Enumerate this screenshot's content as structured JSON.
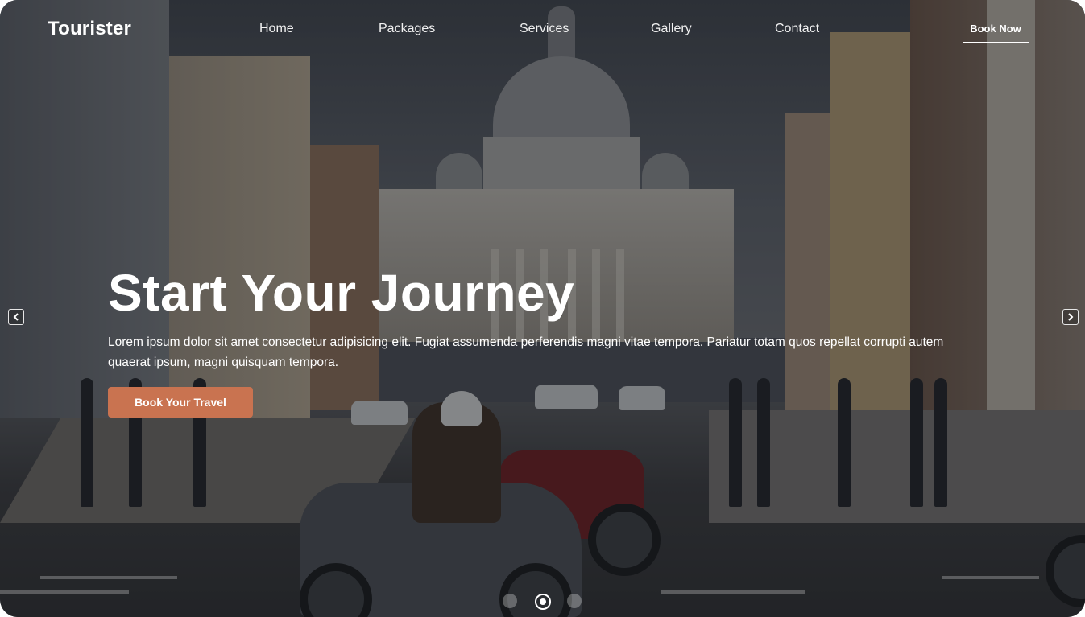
{
  "brand": {
    "name": "Tourister"
  },
  "nav": {
    "links": [
      "Home",
      "Packages",
      "Services",
      "Gallery",
      "Contact"
    ],
    "cta": "Book Now"
  },
  "hero": {
    "title": "Start Your Journey",
    "text": "Lorem ipsum dolor sit amet consectetur adipisicing elit. Fugiat assumenda perferendis magni vitae tempora. Pariatur totam quos repellat corrupti autem quaerat ipsum, magni quisquam tempora.",
    "button": "Book Your Travel"
  },
  "carousel": {
    "prev_icon": "chevron-left-icon",
    "next_icon": "chevron-right-icon",
    "slide_count": 3,
    "active_slide": 2
  },
  "colors": {
    "accent": "#c97350",
    "text": "#ffffff",
    "overlay": "#14161a"
  }
}
